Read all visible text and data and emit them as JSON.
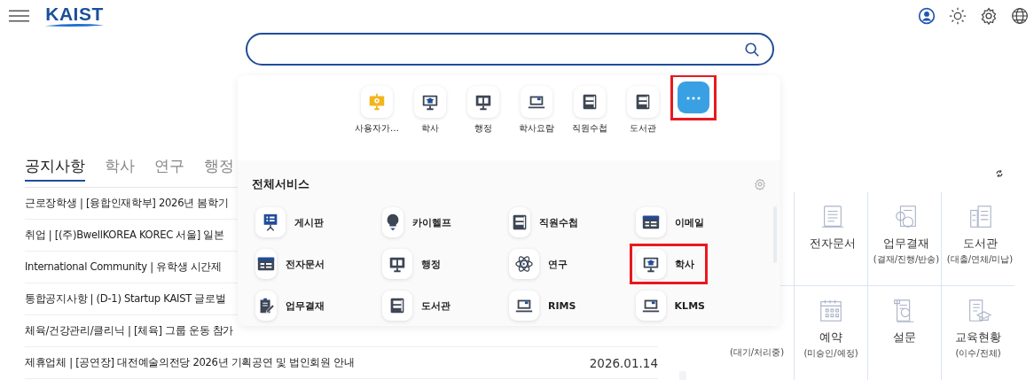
{
  "header": {
    "logo": "KAIST"
  },
  "notices": {
    "tabs": [
      {
        "label": "공지사항",
        "selected": true
      },
      {
        "label": "학사",
        "selected": false
      },
      {
        "label": "연구",
        "selected": false
      },
      {
        "label": "행정",
        "selected": false
      }
    ],
    "rows": [
      {
        "title": "근로장학생 | [융합인재학부] 2026년 봄학기"
      },
      {
        "title": "취업 | [(주)BwellKOREA KOREC 서울] 일본"
      },
      {
        "title": "International Community | 유학생 시간제"
      },
      {
        "title": "통합공지사항 | (D-1) Startup KAIST 글로벌"
      },
      {
        "title": "체육/건강관리/클리닉 | [체육] 그룹 운동 참가"
      },
      {
        "title": "제휴업체 | [공연장] 대전예술의전당 2026년 기획공연 및 법인회원 안내",
        "date": "2026.01.14"
      }
    ]
  },
  "widgets": {
    "rows": [
      [
        null,
        {
          "label": "전자문서"
        },
        {
          "label": "업무결재",
          "sublabel": "(결재/진행/반송)"
        },
        {
          "label": "도서관",
          "sublabel": "(대출/연체/미납)"
        }
      ],
      [
        {
          "sublabel": "(대기/처리중)"
        },
        {
          "label": "예약",
          "sublabel": "(미승인/예정)"
        },
        {
          "label": "설문"
        },
        {
          "label": "교육현황",
          "sublabel": "(이수/전체)"
        }
      ]
    ]
  },
  "quick_menu": {
    "items": [
      {
        "label": "사용자가…",
        "highlighted": false
      },
      {
        "label": "학사",
        "highlighted": false
      },
      {
        "label": "행정",
        "highlighted": false
      },
      {
        "label": "학사요람",
        "highlighted": false
      },
      {
        "label": "직원수첩",
        "highlighted": false
      },
      {
        "label": "도서관",
        "highlighted": false
      }
    ],
    "more_button": {
      "label": "⋯",
      "highlighted": true
    }
  },
  "all_services": {
    "title": "전체서비스",
    "items": [
      {
        "label": "게시판",
        "highlighted": false
      },
      {
        "label": "카이헬프",
        "highlighted": false
      },
      {
        "label": "직원수첩",
        "highlighted": false
      },
      {
        "label": "이메일",
        "highlighted": false
      },
      {
        "label": "전자문서",
        "highlighted": false
      },
      {
        "label": "행정",
        "highlighted": false
      },
      {
        "label": "연구",
        "highlighted": false
      },
      {
        "label": "학사",
        "highlighted": true
      },
      {
        "label": "업무결재",
        "highlighted": false
      },
      {
        "label": "도서관",
        "highlighted": false
      },
      {
        "label": "RIMS",
        "highlighted": false
      },
      {
        "label": "KLMS",
        "highlighted": false
      }
    ]
  }
}
